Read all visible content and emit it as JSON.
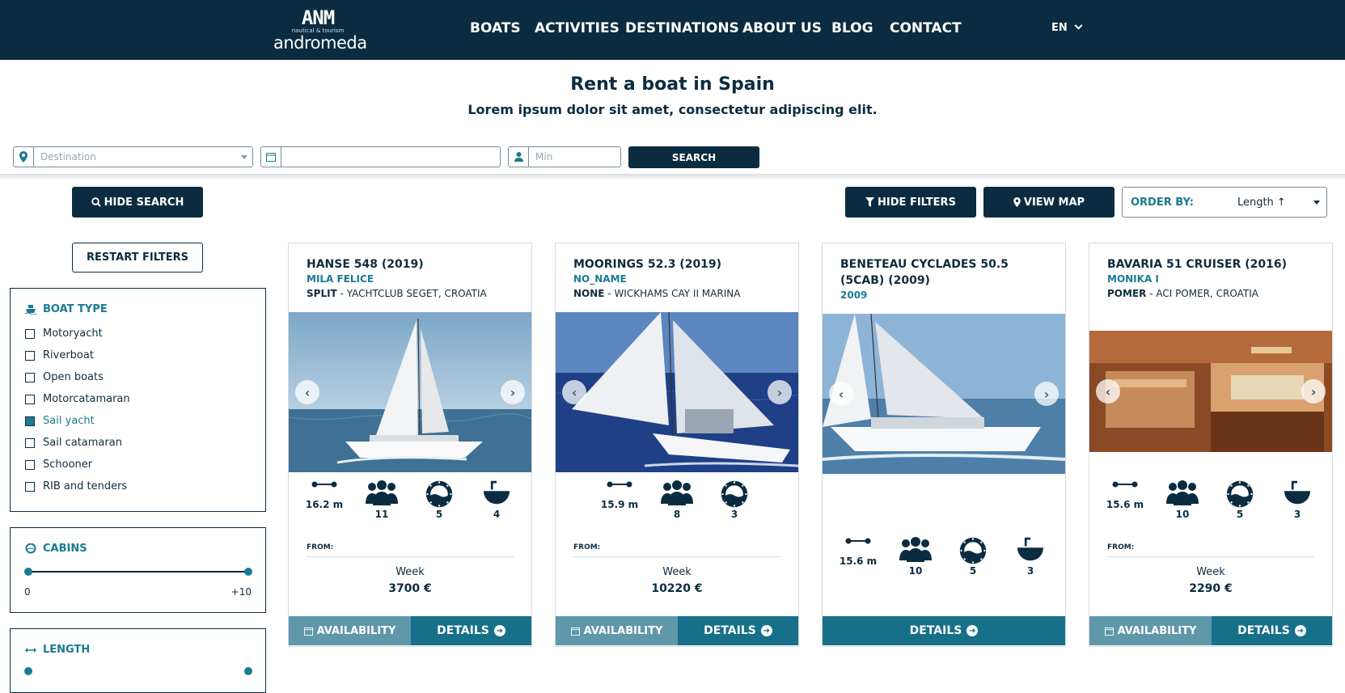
{
  "header": {
    "logo": {
      "mark": "ANM",
      "tagline": "nautical & tourism",
      "name": "andromeda"
    },
    "nav": [
      "BOATS",
      "ACTIVITIES",
      "DESTINATIONS",
      "ABOUT US",
      "BLOG",
      "CONTACT"
    ],
    "language": "EN"
  },
  "hero": {
    "title": "Rent a boat in Spain",
    "subtitle": "Lorem ipsum dolor sit amet, consectetur adipiscing elit."
  },
  "search": {
    "destination_placeholder": "Destination",
    "date_value": "",
    "guests_placeholder": "Min",
    "search_label": "SEARCH"
  },
  "controls": {
    "hide_search": "HIDE SEARCH",
    "restart_filters": "RESTART FILTERS",
    "hide_filters": "HIDE FILTERS",
    "view_map": "VIEW MAP",
    "order_by_label": "ORDER BY:",
    "order_by_value": "Length ↑"
  },
  "filters": {
    "boat_type": {
      "title": "BOAT TYPE",
      "options": [
        {
          "label": "Motoryacht",
          "checked": false
        },
        {
          "label": "Riverboat",
          "checked": false
        },
        {
          "label": "Open boats",
          "checked": false
        },
        {
          "label": "Motorcatamaran",
          "checked": false
        },
        {
          "label": "Sail yacht",
          "checked": true
        },
        {
          "label": "Sail catamaran",
          "checked": false
        },
        {
          "label": "Schooner",
          "checked": false
        },
        {
          "label": "RIB and tenders",
          "checked": false
        }
      ]
    },
    "cabins": {
      "title": "CABINS",
      "min": "0",
      "max": "+10"
    },
    "length": {
      "title": "LENGTH"
    }
  },
  "boats": [
    {
      "title": "HANSE 548 (2019)",
      "name": "MILA FELICE",
      "location_bold": "SPLIT",
      "location_rest": " - YACHTCLUB SEGET, CROATIA",
      "specs": {
        "length": "16.2 m",
        "people": "11",
        "cabins": "5",
        "toilets": "4"
      },
      "from_label": "FROM:",
      "period": "Week",
      "price": "3700 €",
      "availability": "AVAILABILITY",
      "details": "DETAILS"
    },
    {
      "title": "MOORINGS 52.3 (2019)",
      "name": "NO_NAME",
      "location_bold": "NONE",
      "location_rest": " - WICKHAMS CAY II MARINA",
      "specs": {
        "length": "15.9 m",
        "people": "8",
        "cabins": "3"
      },
      "from_label": "FROM:",
      "period": "Week",
      "price": "10220 €",
      "availability": "AVAILABILITY",
      "details": "DETAILS"
    },
    {
      "title": "BENETEAU CYCLADES 50.5 (5CAB) (2009)",
      "name": "2009",
      "specs": {
        "length": "15.6 m",
        "people": "10",
        "cabins": "5",
        "toilets": "3"
      },
      "details": "DETAILS"
    },
    {
      "title": "BAVARIA 51 CRUISER (2016)",
      "name": "MONIKA I",
      "location_bold": "POMER",
      "location_rest": " - ACI POMER, CROATIA",
      "specs": {
        "length": "15.6 m",
        "people": "10",
        "cabins": "5",
        "toilets": "3"
      },
      "from_label": "FROM:",
      "period": "Week",
      "price": "2290 €",
      "availability": "AVAILABILITY",
      "details": "DETAILS"
    }
  ],
  "colors": {
    "navy": "#0b2c40",
    "teal": "#16708a",
    "light_teal": "#5f97ab",
    "accent": "#1a7a92"
  }
}
